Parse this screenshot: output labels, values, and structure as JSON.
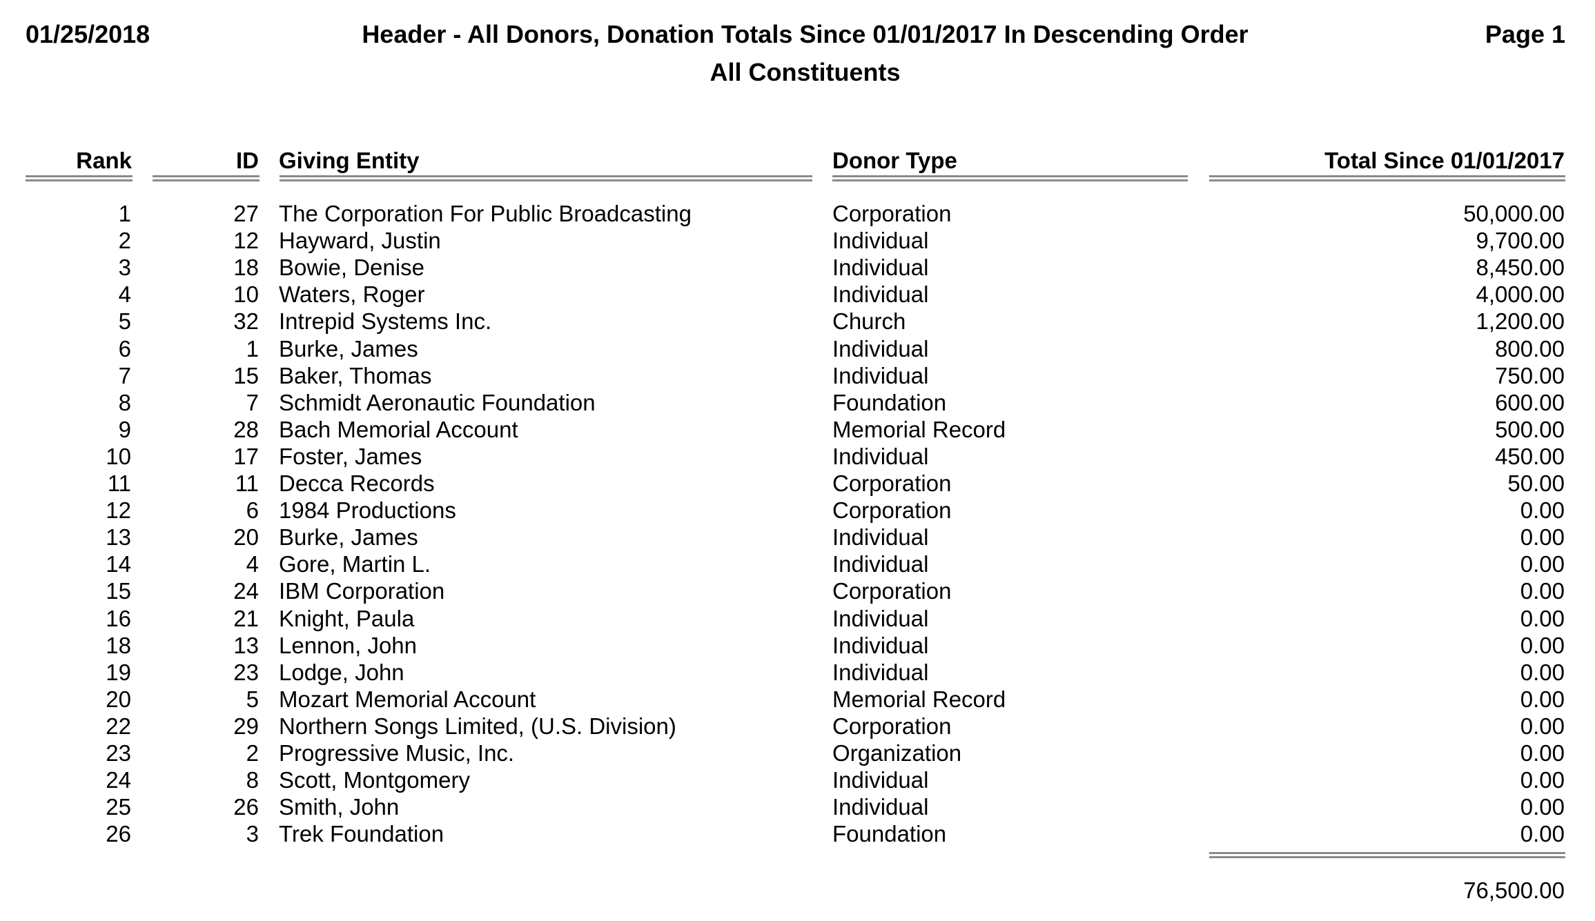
{
  "report": {
    "date": "01/25/2018",
    "title": "Header - All Donors, Donation Totals Since 01/01/2017 In Descending Order",
    "page": "Page 1",
    "subtitle": "All Constituents"
  },
  "columns": {
    "rank": "Rank",
    "id": "ID",
    "entity": "Giving Entity",
    "donor_type": "Donor Type",
    "total": "Total Since 01/01/2017"
  },
  "rows": [
    {
      "rank": "1",
      "id": "27",
      "entity": "The Corporation For Public Broadcasting",
      "donor_type": "Corporation",
      "total": "50,000.00"
    },
    {
      "rank": "2",
      "id": "12",
      "entity": "Hayward, Justin",
      "donor_type": "Individual",
      "total": "9,700.00"
    },
    {
      "rank": "3",
      "id": "18",
      "entity": "Bowie, Denise",
      "donor_type": "Individual",
      "total": "8,450.00"
    },
    {
      "rank": "4",
      "id": "10",
      "entity": "Waters, Roger",
      "donor_type": "Individual",
      "total": "4,000.00"
    },
    {
      "rank": "5",
      "id": "32",
      "entity": "Intrepid Systems Inc.",
      "donor_type": "Church",
      "total": "1,200.00"
    },
    {
      "rank": "6",
      "id": "1",
      "entity": "Burke, James",
      "donor_type": "Individual",
      "total": "800.00"
    },
    {
      "rank": "7",
      "id": "15",
      "entity": "Baker, Thomas",
      "donor_type": "Individual",
      "total": "750.00"
    },
    {
      "rank": "8",
      "id": "7",
      "entity": "Schmidt Aeronautic Foundation",
      "donor_type": "Foundation",
      "total": "600.00"
    },
    {
      "rank": "9",
      "id": "28",
      "entity": "Bach Memorial Account",
      "donor_type": "Memorial Record",
      "total": "500.00"
    },
    {
      "rank": "10",
      "id": "17",
      "entity": "Foster, James",
      "donor_type": "Individual",
      "total": "450.00"
    },
    {
      "rank": "11",
      "id": "11",
      "entity": "Decca Records",
      "donor_type": "Corporation",
      "total": "50.00"
    },
    {
      "rank": "12",
      "id": "6",
      "entity": "1984 Productions",
      "donor_type": "Corporation",
      "total": "0.00"
    },
    {
      "rank": "13",
      "id": "20",
      "entity": "Burke, James",
      "donor_type": "Individual",
      "total": "0.00"
    },
    {
      "rank": "14",
      "id": "4",
      "entity": "Gore, Martin L.",
      "donor_type": "Individual",
      "total": "0.00"
    },
    {
      "rank": "15",
      "id": "24",
      "entity": "IBM Corporation",
      "donor_type": "Corporation",
      "total": "0.00"
    },
    {
      "rank": "16",
      "id": "21",
      "entity": "Knight, Paula",
      "donor_type": "Individual",
      "total": "0.00"
    },
    {
      "rank": "18",
      "id": "13",
      "entity": "Lennon, John",
      "donor_type": "Individual",
      "total": "0.00"
    },
    {
      "rank": "19",
      "id": "23",
      "entity": "Lodge, John",
      "donor_type": "Individual",
      "total": "0.00"
    },
    {
      "rank": "20",
      "id": "5",
      "entity": "Mozart Memorial Account",
      "donor_type": "Memorial Record",
      "total": "0.00"
    },
    {
      "rank": "22",
      "id": "29",
      "entity": "Northern Songs Limited, (U.S. Division)",
      "donor_type": "Corporation",
      "total": "0.00"
    },
    {
      "rank": "23",
      "id": "2",
      "entity": "Progressive Music, Inc.",
      "donor_type": "Organization",
      "total": "0.00"
    },
    {
      "rank": "24",
      "id": "8",
      "entity": "Scott, Montgomery",
      "donor_type": "Individual",
      "total": "0.00"
    },
    {
      "rank": "25",
      "id": "26",
      "entity": "Smith, John",
      "donor_type": "Individual",
      "total": "0.00"
    },
    {
      "rank": "26",
      "id": "3",
      "entity": "Trek Foundation",
      "donor_type": "Foundation",
      "total": "0.00"
    }
  ],
  "grand_total": "76,500.00"
}
